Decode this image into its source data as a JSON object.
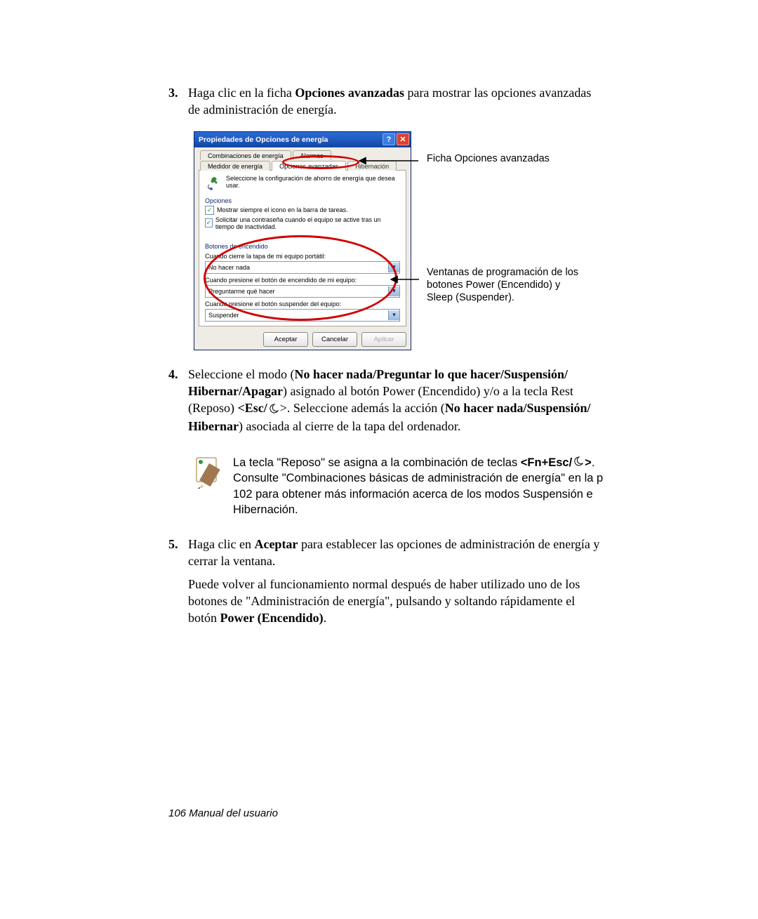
{
  "steps": {
    "s3": {
      "num": "3.",
      "t1": "Haga clic en la ficha ",
      "t2_bold": "Opciones avanzadas",
      "t3": " para mostrar las opciones avanzadas de administración de energía."
    },
    "s4": {
      "num": "4.",
      "t1": "Seleccione el modo (",
      "t2_bold": "No hacer nada/Preguntar lo que hacer/Suspensión/ Hibernar/Apagar",
      "t3": ") asignado al botón Power (Encendido) y/o a la tecla Rest (Reposo) ",
      "t4_bold": "<Esc/",
      "t5": ">. Seleccione además la acción (",
      "t6_bold": "No hacer nada/Suspensión/ Hibernar",
      "t7": ") asociada al cierre de la tapa del ordenador."
    },
    "s5": {
      "num": "5.",
      "t1": "Haga clic en ",
      "t2_bold": "Aceptar",
      "t3": " para establecer las opciones de administración de energía y cerrar la ventana.",
      "p2a": "Puede volver al funcionamiento normal después de haber utilizado uno de los botones de \"Administración de energía\", pulsando y soltando rápidamente el botón ",
      "p2b_bold": "Power (Encendido)",
      "p2c": "."
    }
  },
  "note": {
    "t1": "La tecla \"Reposo\" se asigna a la combinación de teclas ",
    "t2_bold": "<Fn+Esc/",
    "t3_bold": ">",
    "t4": ". Consulte \"Combinaciones básicas de administración de energía\" en la p 102 para obtener más información acerca de los modos Suspensión e Hibernación."
  },
  "dialog": {
    "title": "Propiedades de Opciones de energía",
    "tabs": {
      "t1": "Combinaciones de energía",
      "t2": "Alarmas",
      "t3": "Medidor de energía",
      "t4": "Opciones avanzadas",
      "t5": "Hibernación"
    },
    "desc": "Seleccione la configuración de ahorro de energía que desea usar.",
    "group_options": "Opciones",
    "chk1": "Mostrar siempre el icono en la barra de tareas.",
    "chk2": "Solicitar una contraseña cuando el equipo se active tras un tiempo de inactividad.",
    "group_power": "Botones de encendido",
    "lbl1": "Cuando cierre la tapa de mi equipo portátil:",
    "sel1": "No hacer nada",
    "lbl2": "Cuando presione el botón de encendido de mi equipo:",
    "sel2": "Preguntarme qué hacer",
    "lbl3": "Cuando presione el botón suspender del equipo:",
    "sel3": "Suspender",
    "btns": {
      "ok": "Aceptar",
      "cancel": "Cancelar",
      "apply": "Aplicar"
    }
  },
  "callouts": {
    "c1": "Ficha Opciones avanzadas",
    "c2": "Ventanas de programación de los botones Power (Encendido) y Sleep (Suspender)."
  },
  "footer": "106  Manual del usuario"
}
